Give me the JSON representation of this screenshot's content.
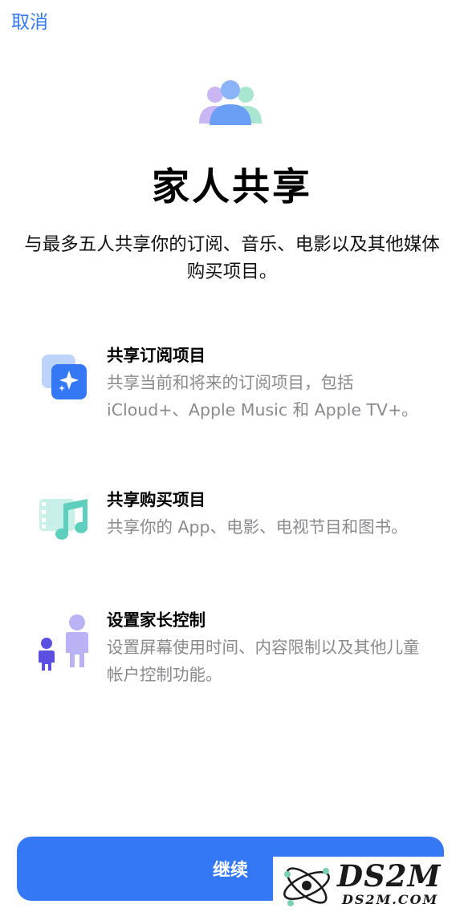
{
  "header": {
    "cancel_label": "取消"
  },
  "hero": {
    "icon": "family-icon",
    "title": "家人共享",
    "subtitle": "与最多五人共享你的订阅、音乐、电影以及其他媒体购买项目。"
  },
  "features": [
    {
      "icon": "subscriptions-icon",
      "title": "共享订阅项目",
      "description": "共享当前和将来的订阅项目，包括iCloud+、Apple Music 和 Apple TV+。"
    },
    {
      "icon": "purchases-icon",
      "title": "共享购买项目",
      "description": "共享你的 App、电影、电视节目和图书。"
    },
    {
      "icon": "parental-controls-icon",
      "title": "设置家长控制",
      "description": "设置屏幕使用时间、内容限制以及其他儿童帐户控制功能。"
    }
  ],
  "footer": {
    "continue_label": "继续"
  },
  "watermark": {
    "logo_text": "DS2M",
    "url_text": "DS2M.COM"
  },
  "colors": {
    "accent": "#3478f6",
    "secondary_text": "#8a8a8e"
  }
}
